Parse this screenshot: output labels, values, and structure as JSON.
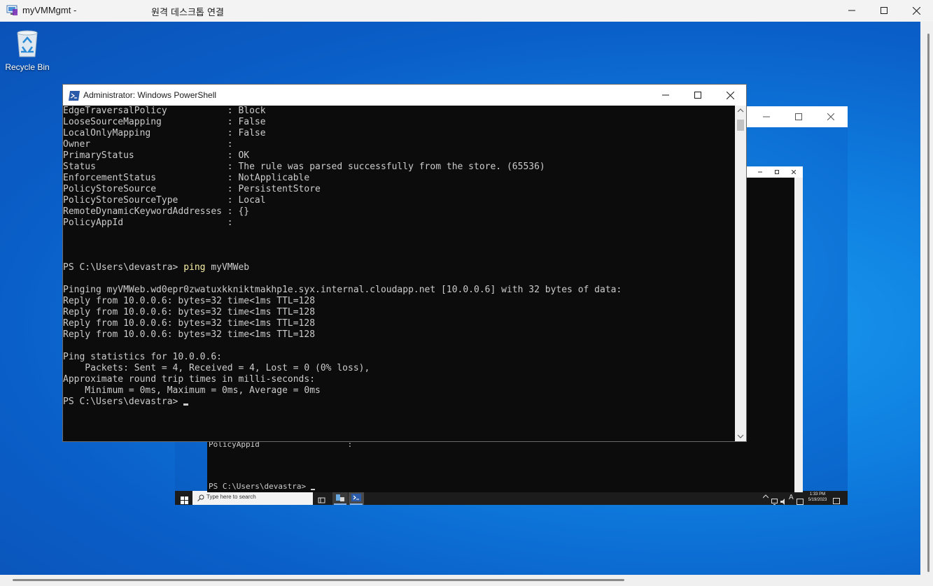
{
  "rdc": {
    "title": "myVMMgmt -",
    "subtitle": "원격 데스크톱 연결"
  },
  "desktop": {
    "recycle_bin_label": "Recycle Bin"
  },
  "powershell": {
    "title": "Administrator: Windows PowerShell",
    "lines": [
      "EdgeTraversalPolicy           : Block",
      "LooseSourceMapping            : False",
      "LocalOnlyMapping              : False",
      "Owner                         :",
      "PrimaryStatus                 : OK",
      "Status                        : The rule was parsed successfully from the store. (65536)",
      "EnforcementStatus             : NotApplicable",
      "PolicyStoreSource             : PersistentStore",
      "PolicyStoreSourceType         : Local",
      "RemoteDynamicKeywordAddresses : {}",
      "PolicyAppId                   :",
      "",
      "",
      "",
      "",
      "",
      "Pinging myVMWeb.wd0epr0zwatuxkkniktmakhp1e.syx.internal.cloudapp.net [10.0.0.6] with 32 bytes of data:",
      "Reply from 10.0.0.6: bytes=32 time<1ms TTL=128",
      "Reply from 10.0.0.6: bytes=32 time<1ms TTL=128",
      "Reply from 10.0.0.6: bytes=32 time<1ms TTL=128",
      "Reply from 10.0.0.6: bytes=32 time<1ms TTL=128",
      "",
      "Ping statistics for 10.0.0.6:",
      "    Packets: Sent = 4, Received = 4, Lost = 0 (0% loss),",
      "Approximate round trip times in milli-seconds:",
      "    Minimum = 0ms, Maximum = 0ms, Average = 0ms"
    ],
    "prompt": "PS C:\\Users\\devastra> ",
    "command": "ping",
    "command_arg": " myVMWeb",
    "final_prompt": "PS C:\\Users\\devastra> "
  },
  "inner_console": {
    "line1": "PolicyAppId                   :",
    "prompt": "PS C:\\Users\\devastra> "
  },
  "vm_taskbar": {
    "search_placeholder": "Type here to search",
    "time": "1:33 PM",
    "date": "5/19/2023",
    "ime": "A"
  }
}
